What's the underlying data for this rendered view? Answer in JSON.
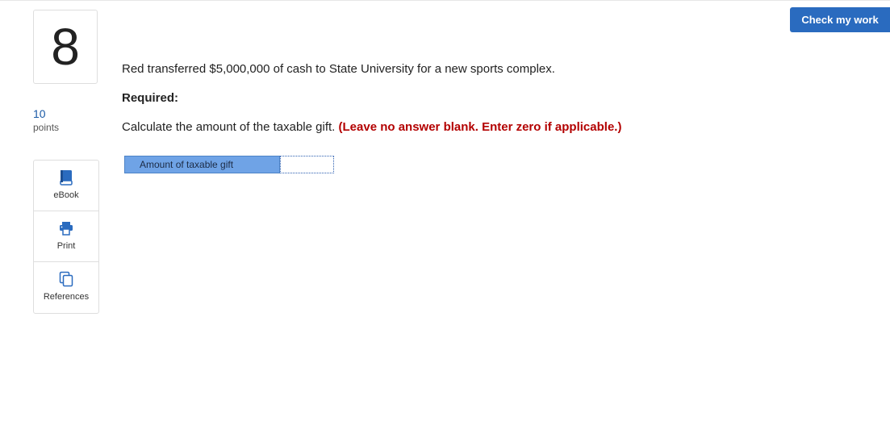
{
  "question": {
    "number": "8",
    "points_value": "10",
    "points_label": "points",
    "text": "Red transferred $5,000,000 of cash to State University for a new sports complex.",
    "required_label": "Required:",
    "instruction": "Calculate the amount of the taxable gift.",
    "instruction_note": "(Leave no answer blank. Enter zero if applicable.)"
  },
  "tools": {
    "items": [
      {
        "label": "eBook",
        "icon": "book-icon"
      },
      {
        "label": "Print",
        "icon": "printer-icon"
      },
      {
        "label": "References",
        "icon": "references-icon"
      }
    ]
  },
  "answer": {
    "row_label": "Amount of taxable gift",
    "value": ""
  },
  "header": {
    "check_button_label": "Check my work"
  },
  "colors": {
    "accent": "#2a6bbf",
    "answer_label_bg": "#6fa3e6",
    "note_red": "#b30000",
    "points_blue": "#1a5aa6"
  }
}
